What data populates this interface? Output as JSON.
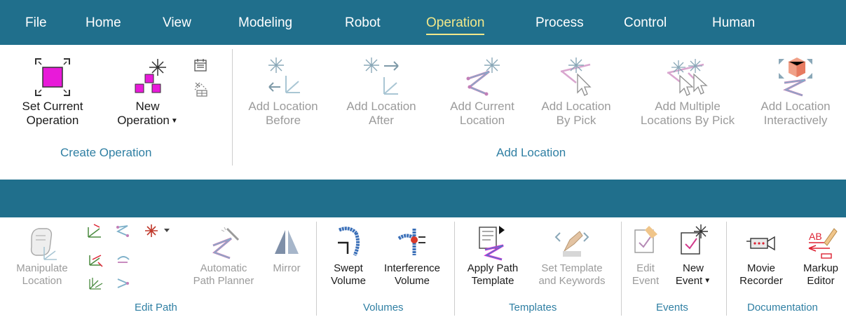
{
  "menu": {
    "items": [
      "File",
      "Home",
      "View",
      "Modeling",
      "Robot",
      "Operation",
      "Process",
      "Control",
      "Human"
    ],
    "active": "Operation"
  },
  "create_operation": {
    "set_current": [
      "Set Current",
      "Operation"
    ],
    "new_operation": [
      "New",
      "Operation"
    ],
    "group_label": "Create Operation"
  },
  "add_location": {
    "before": [
      "Add Location",
      "Before"
    ],
    "after": [
      "Add Location",
      "After"
    ],
    "current": [
      "Add Current",
      "Location"
    ],
    "by_pick": [
      "Add Location",
      "By Pick"
    ],
    "multiple": [
      "Add Multiple",
      "Locations By Pick"
    ],
    "interactive": [
      "Add Location",
      "Interactively"
    ],
    "group_label": "Add Location"
  },
  "edit_path": {
    "manipulate": [
      "Manipulate",
      "Location"
    ],
    "auto_planner": [
      "Automatic",
      "Path Planner"
    ],
    "mirror": [
      "Mirror"
    ],
    "group_label": "Edit Path"
  },
  "volumes": {
    "swept": [
      "Swept",
      "Volume"
    ],
    "interference": [
      "Interference",
      "Volume"
    ],
    "group_label": "Volumes"
  },
  "templates": {
    "apply": [
      "Apply Path",
      "Template"
    ],
    "set": [
      "Set Template",
      "and Keywords"
    ],
    "group_label": "Templates"
  },
  "events": {
    "edit": [
      "Edit",
      "Event"
    ],
    "new": [
      "New",
      "Event"
    ],
    "group_label": "Events"
  },
  "documentation": {
    "movie": [
      "Movie",
      "Recorder"
    ],
    "markup": [
      "Markup",
      "Editor"
    ],
    "group_label": "Documentation"
  },
  "colors": {
    "menubar": "#206f8c",
    "active_tab": "#f2e88a",
    "group_label": "#2f7fa3",
    "magenta": "#e81ad9",
    "disabled_text": "#9b9b9b"
  }
}
